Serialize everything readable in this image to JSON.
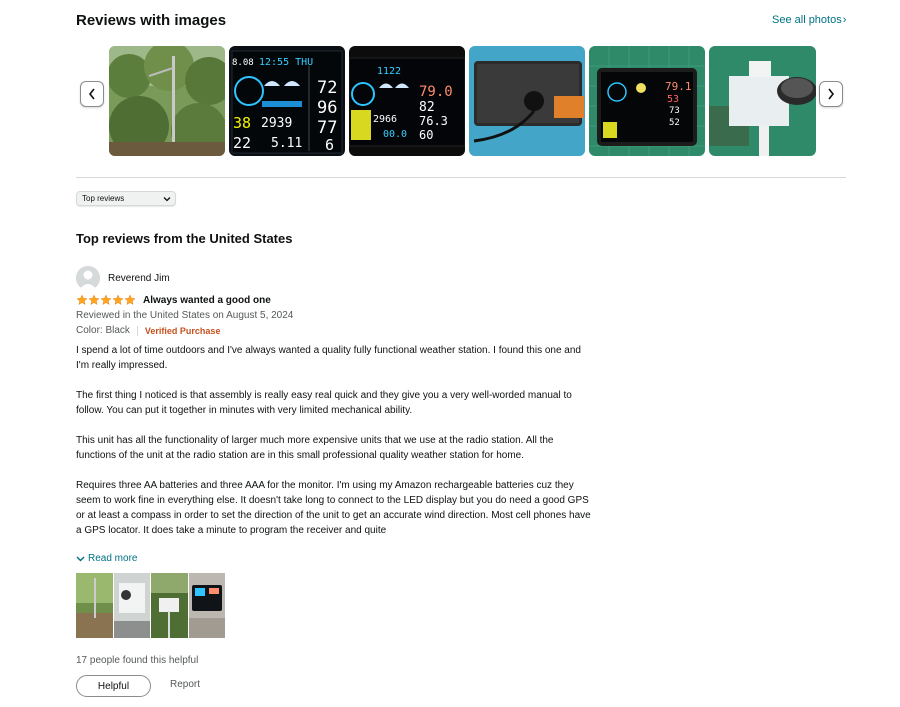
{
  "images_section": {
    "title": "Reviews with images",
    "see_all": "See all photos",
    "thumbnails": [
      {
        "icon": "outdoor-mast-photo"
      },
      {
        "icon": "weather-display-photo",
        "lines": [
          "8.08",
          "12:55 THU",
          "38",
          "2939",
          "22",
          "5.11",
          "72",
          "96",
          "77",
          "6"
        ]
      },
      {
        "icon": "weather-display-photo",
        "lines": [
          "1122",
          "79.0",
          "82",
          "2966",
          "76.3",
          "00.0",
          "60"
        ]
      },
      {
        "icon": "display-back-cable-photo"
      },
      {
        "icon": "weather-display-photo",
        "lines": [
          "79.1",
          "53",
          "73",
          "52"
        ]
      },
      {
        "icon": "sensor-assembly-photo"
      }
    ]
  },
  "sort": {
    "selected": "Top reviews"
  },
  "reviews_heading": "Top reviews from the United States",
  "review": {
    "author": "Reverend Jim",
    "rating": 5,
    "title": "Always wanted a good one",
    "meta": "Reviewed in the United States on August 5, 2024",
    "color": "Color: Black",
    "verified": "Verified Purchase",
    "paragraphs": [
      "I spend a lot of time outdoors and I've always wanted a quality fully functional weather station. I found this one and I'm really impressed.",
      "The first thing I noticed is that assembly is really easy real quick and they give you a very well-worded manual to follow. You can put it together in minutes with very limited mechanical ability.",
      "This unit has all the functionality of larger much more expensive units that we use at the radio station. All the functions of the unit at the radio station are in this small professional quality weather station for home.",
      "Requires three AA batteries and three AAA for the monitor. I'm using my Amazon rechargeable batteries cuz they seem to work fine in everything else. It doesn't take long to connect to the LED display but you do need a good GPS or at least a compass in order to set the direction of the unit to get an accurate wind direction. Most cell phones have a GPS locator. It does take a minute to program the receiver and quite"
    ],
    "read_more": "Read more",
    "helpful_text": "17 people found this helpful",
    "helpful_button": "Helpful",
    "report": "Report"
  },
  "colors": {
    "link": "#007185",
    "star": "#FFA41C",
    "verified": "#C7511F",
    "text": "#0F1111",
    "secondary": "#565959"
  }
}
